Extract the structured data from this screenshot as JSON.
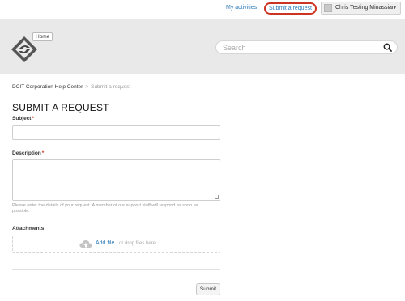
{
  "top_nav": {
    "my_activities": "My activities",
    "submit_request": "Submit a request",
    "user_name": "Chris Testing Minassian",
    "user_caret": "▼"
  },
  "header": {
    "home_label": "Home",
    "search_placeholder": "Search",
    "logo_icon": "helpcenter-logo-icon",
    "search_icon": "search-icon"
  },
  "breadcrumb": {
    "root": "DCIT Corporation Help Center",
    "separator": ">",
    "current": "Submit a request"
  },
  "form": {
    "title": "SUBMIT A REQUEST",
    "subject_label": "Subject",
    "description_label": "Description",
    "required_mark": "*",
    "description_hint": "Please enter the details of your request. A member of our support staff will respond as soon as possible.",
    "attachments_label": "Attachments",
    "add_file": "Add file",
    "drop_text": "or drop files here",
    "submit_label": "Submit"
  },
  "colors": {
    "link": "#2b7bb9",
    "highlight_ring": "#cc3322",
    "header_bg": "#e9e9e9"
  }
}
